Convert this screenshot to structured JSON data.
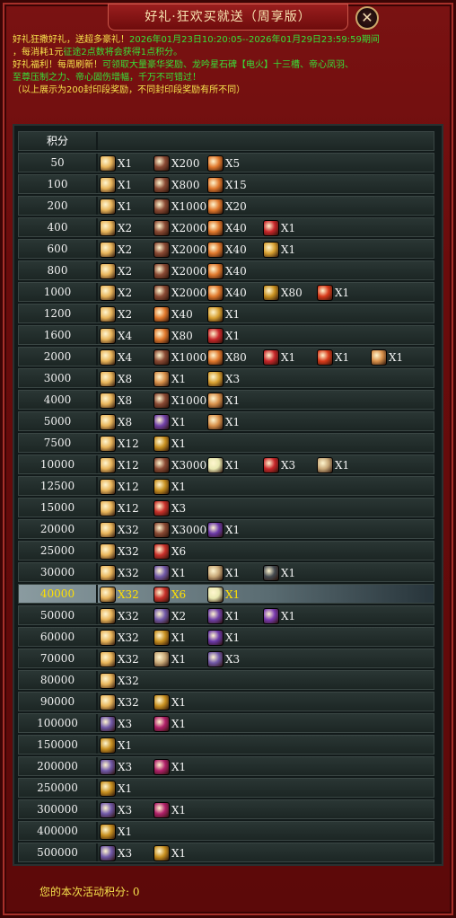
{
  "title": "好礼·狂欢买就送（周享版）",
  "close_glyph": "✕",
  "notice": {
    "line1_prefix": "好礼狂撒好礼，送超多豪礼！",
    "line1_period": "2026年01月23日10:20:05--2026年01月29日23:59:59期间",
    "line2_a": "，每消耗1元",
    "line2_b": "征途2点数将会获得1点积分。",
    "line3_a": "好礼福利！每周刷新！",
    "line3_b": "可领取大量豪华奖励、龙吟星石碑【电火】十三槽、帝心凤羽、",
    "line4": "至尊压制之力、帝心固伤增幅，千万不可错过！",
    "line5": "（以上展示为200封印段奖励，不同封印段奖励有所不同）"
  },
  "header_label": "积分",
  "icon_colors": {
    "box": "#e8b45a",
    "ore": "#8a4a34",
    "feather": "#e0782c",
    "gift": "#c8262a",
    "giftgold": "#d8a030",
    "coin": "#c89020",
    "orb": "#d83a1a",
    "flower": "#d8904a",
    "flask": "#b0206a",
    "purplegift": "#7040a8",
    "spark": "#e8e8b0",
    "chest": "#c8a878",
    "scroll": "#7058a8",
    "helmet": "#444a50",
    "purplebook": "#7a3ab0",
    "purpleore": "#6a38a8",
    "redgem": "#c8302a"
  },
  "rows": [
    {
      "points": "50",
      "items": [
        {
          "icon": "box",
          "qty": "X1"
        },
        {
          "icon": "ore",
          "qty": "X200"
        },
        {
          "icon": "feather",
          "qty": "X5"
        }
      ]
    },
    {
      "points": "100",
      "items": [
        {
          "icon": "box",
          "qty": "X1"
        },
        {
          "icon": "ore",
          "qty": "X800"
        },
        {
          "icon": "feather",
          "qty": "X15"
        }
      ]
    },
    {
      "points": "200",
      "items": [
        {
          "icon": "box",
          "qty": "X1"
        },
        {
          "icon": "ore",
          "qty": "X1000"
        },
        {
          "icon": "feather",
          "qty": "X20"
        }
      ]
    },
    {
      "points": "400",
      "items": [
        {
          "icon": "box",
          "qty": "X2"
        },
        {
          "icon": "ore",
          "qty": "X2000"
        },
        {
          "icon": "feather",
          "qty": "X40"
        },
        {
          "icon": "gift",
          "qty": "X1"
        }
      ]
    },
    {
      "points": "600",
      "items": [
        {
          "icon": "box",
          "qty": "X2"
        },
        {
          "icon": "ore",
          "qty": "X2000"
        },
        {
          "icon": "feather",
          "qty": "X40"
        },
        {
          "icon": "giftgold",
          "qty": "X1"
        }
      ]
    },
    {
      "points": "800",
      "items": [
        {
          "icon": "box",
          "qty": "X2"
        },
        {
          "icon": "ore",
          "qty": "X2000"
        },
        {
          "icon": "feather",
          "qty": "X40"
        }
      ]
    },
    {
      "points": "1000",
      "items": [
        {
          "icon": "box",
          "qty": "X2"
        },
        {
          "icon": "ore",
          "qty": "X2000"
        },
        {
          "icon": "feather",
          "qty": "X40"
        },
        {
          "icon": "coin",
          "qty": "X80"
        },
        {
          "icon": "orb",
          "qty": "X1"
        }
      ]
    },
    {
      "points": "1200",
      "items": [
        {
          "icon": "box",
          "qty": "X2"
        },
        {
          "icon": "feather",
          "qty": "X40"
        },
        {
          "icon": "giftgold",
          "qty": "X1"
        }
      ]
    },
    {
      "points": "1600",
      "items": [
        {
          "icon": "box",
          "qty": "X4"
        },
        {
          "icon": "feather",
          "qty": "X80"
        },
        {
          "icon": "gift",
          "qty": "X1"
        }
      ]
    },
    {
      "points": "2000",
      "items": [
        {
          "icon": "box",
          "qty": "X4"
        },
        {
          "icon": "ore",
          "qty": "X1000"
        },
        {
          "icon": "feather",
          "qty": "X80"
        },
        {
          "icon": "gift",
          "qty": "X1"
        },
        {
          "icon": "orb",
          "qty": "X1"
        },
        {
          "icon": "flower",
          "qty": "X1"
        }
      ]
    },
    {
      "points": "3000",
      "items": [
        {
          "icon": "box",
          "qty": "X8"
        },
        {
          "icon": "flower",
          "qty": "X1"
        },
        {
          "icon": "giftgold",
          "qty": "X3"
        }
      ]
    },
    {
      "points": "4000",
      "items": [
        {
          "icon": "box",
          "qty": "X8"
        },
        {
          "icon": "ore",
          "qty": "X1000"
        },
        {
          "icon": "flower",
          "qty": "X1"
        }
      ]
    },
    {
      "points": "5000",
      "items": [
        {
          "icon": "box",
          "qty": "X8"
        },
        {
          "icon": "purplegift",
          "qty": "X1"
        },
        {
          "icon": "flower",
          "qty": "X1"
        }
      ]
    },
    {
      "points": "7500",
      "items": [
        {
          "icon": "box",
          "qty": "X12"
        },
        {
          "icon": "coin",
          "qty": "X1"
        }
      ]
    },
    {
      "points": "10000",
      "items": [
        {
          "icon": "box",
          "qty": "X12"
        },
        {
          "icon": "ore",
          "qty": "X3000"
        },
        {
          "icon": "spark",
          "qty": "X1"
        },
        {
          "icon": "gift",
          "qty": "X3"
        },
        {
          "icon": "chest",
          "qty": "X1"
        }
      ]
    },
    {
      "points": "12500",
      "items": [
        {
          "icon": "box",
          "qty": "X12"
        },
        {
          "icon": "coin",
          "qty": "X1"
        }
      ]
    },
    {
      "points": "15000",
      "items": [
        {
          "icon": "box",
          "qty": "X12"
        },
        {
          "icon": "redgem",
          "qty": "X3"
        }
      ]
    },
    {
      "points": "20000",
      "items": [
        {
          "icon": "box",
          "qty": "X32"
        },
        {
          "icon": "ore",
          "qty": "X3000"
        },
        {
          "icon": "purpleore",
          "qty": "X1"
        }
      ]
    },
    {
      "points": "25000",
      "items": [
        {
          "icon": "box",
          "qty": "X32"
        },
        {
          "icon": "redgem",
          "qty": "X6"
        }
      ]
    },
    {
      "points": "30000",
      "items": [
        {
          "icon": "box",
          "qty": "X32"
        },
        {
          "icon": "scroll",
          "qty": "X1"
        },
        {
          "icon": "chest",
          "qty": "X1"
        },
        {
          "icon": "helmet",
          "qty": "X1"
        }
      ]
    },
    {
      "points": "40000",
      "highlight": true,
      "items": [
        {
          "icon": "box",
          "qty": "X32"
        },
        {
          "icon": "redgem",
          "qty": "X6"
        },
        {
          "icon": "spark",
          "qty": "X1"
        }
      ]
    },
    {
      "points": "50000",
      "items": [
        {
          "icon": "box",
          "qty": "X32"
        },
        {
          "icon": "scroll",
          "qty": "X2"
        },
        {
          "icon": "purplegift",
          "qty": "X1"
        },
        {
          "icon": "purplebook",
          "qty": "X1"
        }
      ]
    },
    {
      "points": "60000",
      "items": [
        {
          "icon": "box",
          "qty": "X32"
        },
        {
          "icon": "coin",
          "qty": "X1"
        },
        {
          "icon": "purpleore",
          "qty": "X1"
        }
      ]
    },
    {
      "points": "70000",
      "items": [
        {
          "icon": "box",
          "qty": "X32"
        },
        {
          "icon": "chest",
          "qty": "X1"
        },
        {
          "icon": "scroll",
          "qty": "X3"
        }
      ]
    },
    {
      "points": "80000",
      "items": [
        {
          "icon": "box",
          "qty": "X32"
        }
      ]
    },
    {
      "points": "90000",
      "items": [
        {
          "icon": "box",
          "qty": "X32"
        },
        {
          "icon": "coin",
          "qty": "X1"
        }
      ]
    },
    {
      "points": "100000",
      "items": [
        {
          "icon": "scroll",
          "qty": "X3"
        },
        {
          "icon": "flask",
          "qty": "X1"
        }
      ]
    },
    {
      "points": "150000",
      "items": [
        {
          "icon": "coin",
          "qty": "X1"
        }
      ]
    },
    {
      "points": "200000",
      "items": [
        {
          "icon": "scroll",
          "qty": "X3"
        },
        {
          "icon": "flask",
          "qty": "X1"
        }
      ]
    },
    {
      "points": "250000",
      "items": [
        {
          "icon": "coin",
          "qty": "X1"
        }
      ]
    },
    {
      "points": "300000",
      "items": [
        {
          "icon": "scroll",
          "qty": "X3"
        },
        {
          "icon": "flask",
          "qty": "X1"
        }
      ]
    },
    {
      "points": "400000",
      "items": [
        {
          "icon": "coin",
          "qty": "X1"
        }
      ]
    },
    {
      "points": "500000",
      "items": [
        {
          "icon": "scroll",
          "qty": "X3"
        },
        {
          "icon": "coin",
          "qty": "X1"
        }
      ]
    }
  ],
  "footer": "您的本次活动积分:  0"
}
